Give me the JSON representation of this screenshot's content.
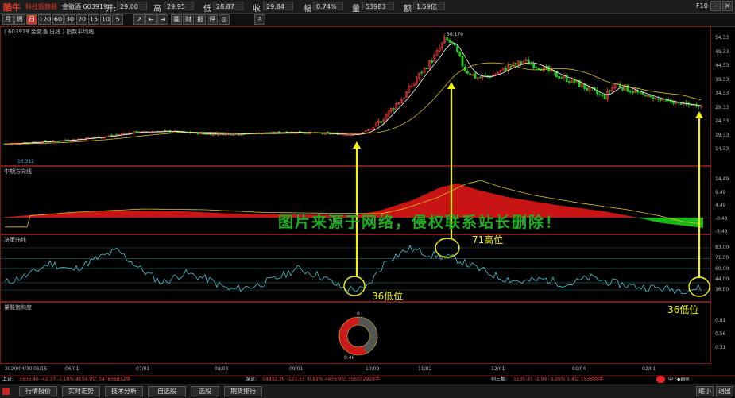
{
  "app": {
    "logo": "酷牛",
    "edition": "科技版旗舰",
    "stock_short": "金徽酒 603919"
  },
  "quote": {
    "open_label": "开:",
    "open_value": "29.00",
    "high_label": "高",
    "high_value": "29.95",
    "low_label": "低",
    "low_value": "28.87",
    "close_label": "收",
    "close_value": "29.84",
    "amp_label": "幅",
    "amp_value": "0.74%",
    "vol_label": "量",
    "vol_value": "53983",
    "amt_label": "额",
    "amt_value": "1.59亿"
  },
  "window": {
    "f10": "F10"
  },
  "periods": [
    "月",
    "周",
    "日",
    "120",
    "60",
    "30",
    "20",
    "15",
    "10",
    "5"
  ],
  "tools": [
    "画",
    "财",
    "报",
    "评",
    "◎"
  ],
  "main_panel": {
    "title": "( 603919 金徽酒 日线 ) 指数平均线",
    "peak_label": "56.170",
    "low_label": "16.312",
    "y_ticks": [
      "54.33",
      "49.33",
      "44.33",
      "39.33",
      "34.33",
      "29.33",
      "24.33",
      "19.33",
      "14.33"
    ],
    "y_values": [
      54.33,
      49.33,
      44.33,
      39.33,
      34.33,
      29.33,
      24.33,
      19.33,
      14.33
    ]
  },
  "mid_panel": {
    "title": "中期方向线",
    "y_ticks": [
      "14.49",
      "9.49",
      "4.49",
      "-0.49",
      "-5.49"
    ]
  },
  "dec_panel": {
    "title": "决策曲线",
    "y_ticks": [
      "83.00",
      "71.00",
      "60.00",
      "44.00",
      "36.00"
    ]
  },
  "sat_panel": {
    "title": "量能饱和度",
    "y_ticks": [
      "0.81",
      "0.56",
      "0.31"
    ],
    "ring_top": "0",
    "ring_bottom": "0.46"
  },
  "xaxis": [
    "2020/04/30",
    "05/15",
    "06/01",
    "07/01",
    "08/03",
    "09/01",
    "10/09",
    "11/02",
    "12/01",
    "01/04",
    "02/01"
  ],
  "annotations": {
    "a1": "36低位",
    "a2": "71高位",
    "a3": "36低位"
  },
  "watermark": "图片来源于网络，侵权联系站长删除！",
  "status": {
    "sh_label": "上证:",
    "sh_value": "3536.46 -42.37 -1.18% 4154.9亿 347656832手",
    "sz_label": "深证:",
    "sz_value": "14932.26 -121.37 -0.81% 4476.9亿 355072928手",
    "cy_label": "创三板:",
    "cy_value": "1135.45 -2.94 -0.26% 1.4亿 153888手"
  },
  "tabs": [
    "行情报价",
    "实时走势",
    "技术分析",
    "自选股",
    "选股",
    "期货排行"
  ],
  "bottom_right": {
    "shrink": "缩小",
    "quit": "退出"
  },
  "chart_data": [
    {
      "type": "candlestick",
      "name": "金徽酒 日线",
      "x": [
        "2020/04/30",
        "05/15",
        "06/01",
        "07/01",
        "08/03",
        "09/01",
        "10/09",
        "11/02",
        "12/01",
        "01/04",
        "02/01"
      ],
      "close_approx": [
        16.3,
        17.0,
        18.5,
        21.0,
        20.0,
        20.5,
        20.0,
        52.0,
        45.0,
        38.0,
        29.84
      ],
      "ylim": [
        12,
        57
      ],
      "peak": 56.17
    },
    {
      "type": "line",
      "name": "决策曲线",
      "levels": [
        83,
        71,
        60,
        44,
        36
      ],
      "values": [
        44,
        52,
        66,
        58,
        70,
        80,
        60,
        44,
        55,
        48,
        36,
        40,
        48,
        60,
        52,
        38,
        36,
        70,
        82,
        75,
        71,
        60,
        50,
        45,
        48,
        42,
        50,
        44,
        40,
        38,
        36,
        38
      ]
    }
  ]
}
